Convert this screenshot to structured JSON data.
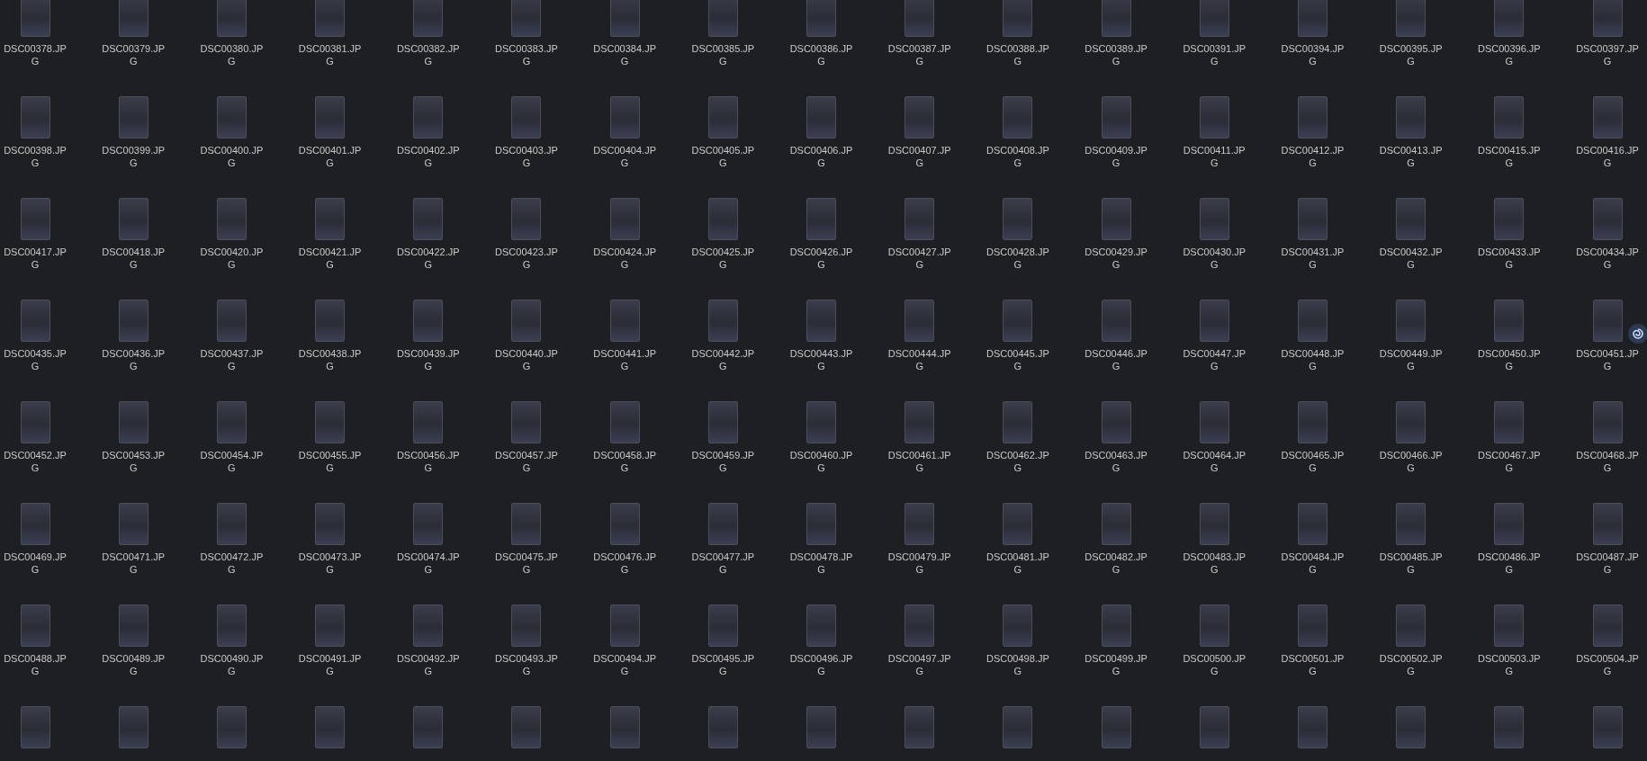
{
  "files": [
    {
      "kind": "labeled",
      "name": "DSC00378.JPG"
    },
    {
      "kind": "labeled",
      "name": "DSC00379.JPG"
    },
    {
      "kind": "labeled",
      "name": "DSC00380.JPG"
    },
    {
      "kind": "labeled",
      "name": "DSC00381.JPG"
    },
    {
      "kind": "labeled",
      "name": "DSC00382.JPG"
    },
    {
      "kind": "labeled",
      "name": "DSC00383.JPG"
    },
    {
      "kind": "labeled",
      "name": "DSC00384.JPG"
    },
    {
      "kind": "labeled",
      "name": "DSC00385.JPG"
    },
    {
      "kind": "labeled",
      "name": "DSC00386.JPG"
    },
    {
      "kind": "labeled",
      "name": "DSC00387.JPG"
    },
    {
      "kind": "labeled",
      "name": "DSC00388.JPG"
    },
    {
      "kind": "labeled",
      "name": "DSC00389.JPG"
    },
    {
      "kind": "labeled",
      "name": "DSC00391.JPG"
    },
    {
      "kind": "labeled",
      "name": "DSC00394.JPG"
    },
    {
      "kind": "labeled",
      "name": "DSC00395.JPG"
    },
    {
      "kind": "labeled",
      "name": "DSC00396.JPG"
    },
    {
      "kind": "labeled",
      "name": "DSC00397.JPG"
    },
    {
      "kind": "labeled",
      "name": "DSC00398.JPG"
    },
    {
      "kind": "labeled",
      "name": "DSC00399.JPG"
    },
    {
      "kind": "labeled",
      "name": "DSC00400.JPG"
    },
    {
      "kind": "labeled",
      "name": "DSC00401.JPG"
    },
    {
      "kind": "labeled",
      "name": "DSC00402.JPG"
    },
    {
      "kind": "labeled",
      "name": "DSC00403.JPG"
    },
    {
      "kind": "labeled",
      "name": "DSC00404.JPG"
    },
    {
      "kind": "labeled",
      "name": "DSC00405.JPG"
    },
    {
      "kind": "labeled",
      "name": "DSC00406.JPG"
    },
    {
      "kind": "labeled",
      "name": "DSC00407.JPG"
    },
    {
      "kind": "labeled",
      "name": "DSC00408.JPG"
    },
    {
      "kind": "labeled",
      "name": "DSC00409.JPG"
    },
    {
      "kind": "labeled",
      "name": "DSC00411.JPG"
    },
    {
      "kind": "labeled",
      "name": "DSC00412.JPG"
    },
    {
      "kind": "labeled",
      "name": "DSC00413.JPG"
    },
    {
      "kind": "labeled",
      "name": "DSC00415.JPG"
    },
    {
      "kind": "labeled",
      "name": "DSC00416.JPG"
    },
    {
      "kind": "labeled",
      "name": "DSC00417.JPG"
    },
    {
      "kind": "labeled",
      "name": "DSC00418.JPG"
    },
    {
      "kind": "labeled",
      "name": "DSC00420.JPG"
    },
    {
      "kind": "labeled",
      "name": "DSC00421.JPG"
    },
    {
      "kind": "labeled",
      "name": "DSC00422.JPG"
    },
    {
      "kind": "labeled",
      "name": "DSC00423.JPG"
    },
    {
      "kind": "labeled",
      "name": "DSC00424.JPG"
    },
    {
      "kind": "labeled",
      "name": "DSC00425.JPG"
    },
    {
      "kind": "labeled",
      "name": "DSC00426.JPG"
    },
    {
      "kind": "labeled",
      "name": "DSC00427.JPG"
    },
    {
      "kind": "labeled",
      "name": "DSC00428.JPG"
    },
    {
      "kind": "labeled",
      "name": "DSC00429.JPG"
    },
    {
      "kind": "labeled",
      "name": "DSC00430.JPG"
    },
    {
      "kind": "labeled",
      "name": "DSC00431.JPG"
    },
    {
      "kind": "labeled",
      "name": "DSC00432.JPG"
    },
    {
      "kind": "labeled",
      "name": "DSC00433.JPG"
    },
    {
      "kind": "labeled",
      "name": "DSC00434.JPG"
    },
    {
      "kind": "labeled",
      "name": "DSC00435.JPG"
    },
    {
      "kind": "labeled",
      "name": "DSC00436.JPG"
    },
    {
      "kind": "labeled",
      "name": "DSC00437.JPG"
    },
    {
      "kind": "labeled",
      "name": "DSC00438.JPG"
    },
    {
      "kind": "labeled",
      "name": "DSC00439.JPG"
    },
    {
      "kind": "labeled",
      "name": "DSC00440.JPG"
    },
    {
      "kind": "labeled",
      "name": "DSC00441.JPG"
    },
    {
      "kind": "labeled",
      "name": "DSC00442.JPG"
    },
    {
      "kind": "labeled",
      "name": "DSC00443.JPG"
    },
    {
      "kind": "labeled",
      "name": "DSC00444.JPG"
    },
    {
      "kind": "labeled",
      "name": "DSC00445.JPG"
    },
    {
      "kind": "labeled",
      "name": "DSC00446.JPG"
    },
    {
      "kind": "labeled",
      "name": "DSC00447.JPG"
    },
    {
      "kind": "labeled",
      "name": "DSC00448.JPG"
    },
    {
      "kind": "labeled",
      "name": "DSC00449.JPG"
    },
    {
      "kind": "labeled",
      "name": "DSC00450.JPG"
    },
    {
      "kind": "labeled",
      "name": "DSC00451.JPG"
    },
    {
      "kind": "labeled",
      "name": "DSC00452.JPG"
    },
    {
      "kind": "labeled",
      "name": "DSC00453.JPG"
    },
    {
      "kind": "labeled",
      "name": "DSC00454.JPG"
    },
    {
      "kind": "labeled",
      "name": "DSC00455.JPG"
    },
    {
      "kind": "labeled",
      "name": "DSC00456.JPG"
    },
    {
      "kind": "labeled",
      "name": "DSC00457.JPG"
    },
    {
      "kind": "labeled",
      "name": "DSC00458.JPG"
    },
    {
      "kind": "labeled",
      "name": "DSC00459.JPG"
    },
    {
      "kind": "labeled",
      "name": "DSC00460.JPG"
    },
    {
      "kind": "labeled",
      "name": "DSC00461.JPG"
    },
    {
      "kind": "labeled",
      "name": "DSC00462.JPG"
    },
    {
      "kind": "labeled",
      "name": "DSC00463.JPG"
    },
    {
      "kind": "labeled",
      "name": "DSC00464.JPG"
    },
    {
      "kind": "labeled",
      "name": "DSC00465.JPG"
    },
    {
      "kind": "labeled",
      "name": "DSC00466.JPG"
    },
    {
      "kind": "labeled",
      "name": "DSC00467.JPG"
    },
    {
      "kind": "labeled",
      "name": "DSC00468.JPG"
    },
    {
      "kind": "labeled",
      "name": "DSC00469.JPG"
    },
    {
      "kind": "labeled",
      "name": "DSC00471.JPG"
    },
    {
      "kind": "labeled",
      "name": "DSC00472.JPG"
    },
    {
      "kind": "labeled",
      "name": "DSC00473.JPG"
    },
    {
      "kind": "labeled",
      "name": "DSC00474.JPG"
    },
    {
      "kind": "labeled",
      "name": "DSC00475.JPG"
    },
    {
      "kind": "labeled",
      "name": "DSC00476.JPG"
    },
    {
      "kind": "labeled",
      "name": "DSC00477.JPG"
    },
    {
      "kind": "labeled",
      "name": "DSC00478.JPG"
    },
    {
      "kind": "labeled",
      "name": "DSC00479.JPG"
    },
    {
      "kind": "labeled",
      "name": "DSC00481.JPG"
    },
    {
      "kind": "labeled",
      "name": "DSC00482.JPG"
    },
    {
      "kind": "labeled",
      "name": "DSC00483.JPG"
    },
    {
      "kind": "labeled",
      "name": "DSC00484.JPG"
    },
    {
      "kind": "labeled",
      "name": "DSC00485.JPG"
    },
    {
      "kind": "labeled",
      "name": "DSC00486.JPG"
    },
    {
      "kind": "labeled",
      "name": "DSC00487.JPG"
    },
    {
      "kind": "labeled",
      "name": "DSC00488.JPG"
    },
    {
      "kind": "labeled",
      "name": "DSC00489.JPG"
    },
    {
      "kind": "labeled",
      "name": "DSC00490.JPG"
    },
    {
      "kind": "labeled",
      "name": "DSC00491.JPG"
    },
    {
      "kind": "labeled",
      "name": "DSC00492.JPG"
    },
    {
      "kind": "labeled",
      "name": "DSC00493.JPG"
    },
    {
      "kind": "labeled",
      "name": "DSC00494.JPG"
    },
    {
      "kind": "labeled",
      "name": "DSC00495.JPG"
    },
    {
      "kind": "labeled",
      "name": "DSC00496.JPG"
    },
    {
      "kind": "labeled",
      "name": "DSC00497.JPG"
    },
    {
      "kind": "labeled",
      "name": "DSC00498.JPG"
    },
    {
      "kind": "labeled",
      "name": "DSC00499.JPG"
    },
    {
      "kind": "labeled",
      "name": "DSC00500.JPG"
    },
    {
      "kind": "labeled",
      "name": "DSC00501.JPG"
    },
    {
      "kind": "labeled",
      "name": "DSC00502.JPG"
    },
    {
      "kind": "labeled",
      "name": "DSC00503.JPG"
    },
    {
      "kind": "labeled",
      "name": "DSC00504.JPG"
    },
    {
      "kind": "unlabeled"
    },
    {
      "kind": "unlabeled"
    },
    {
      "kind": "unlabeled"
    },
    {
      "kind": "unlabeled"
    },
    {
      "kind": "unlabeled"
    },
    {
      "kind": "unlabeled"
    },
    {
      "kind": "unlabeled"
    },
    {
      "kind": "unlabeled"
    },
    {
      "kind": "unlabeled"
    },
    {
      "kind": "unlabeled"
    },
    {
      "kind": "unlabeled"
    },
    {
      "kind": "unlabeled"
    },
    {
      "kind": "unlabeled"
    },
    {
      "kind": "unlabeled"
    },
    {
      "kind": "unlabeled"
    },
    {
      "kind": "unlabeled"
    },
    {
      "kind": "unlabeled"
    }
  ]
}
